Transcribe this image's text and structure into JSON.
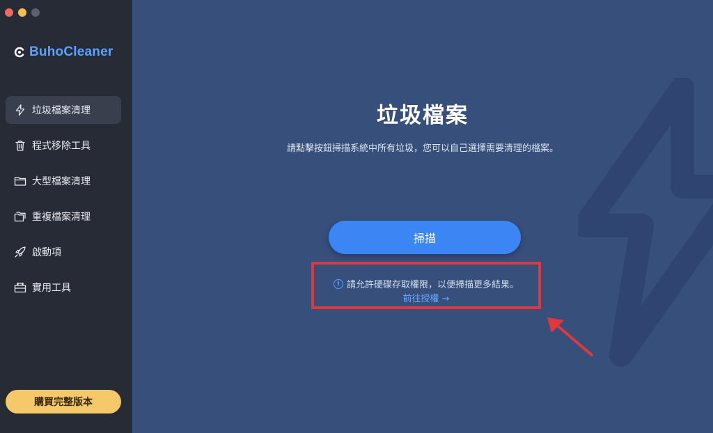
{
  "app": {
    "name": "BuhoCleaner"
  },
  "sidebar": {
    "items": [
      {
        "label": "垃圾檔案清理",
        "icon": "lightning-icon",
        "active": true
      },
      {
        "label": "程式移除工具",
        "icon": "trash-icon",
        "active": false
      },
      {
        "label": "大型檔案清理",
        "icon": "folder-icon",
        "active": false
      },
      {
        "label": "重複檔案清理",
        "icon": "duplicate-folder-icon",
        "active": false
      },
      {
        "label": "啟動項",
        "icon": "rocket-icon",
        "active": false
      },
      {
        "label": "實用工具",
        "icon": "toolbox-icon",
        "active": false
      }
    ],
    "buy_label": "購買完整版本"
  },
  "main": {
    "title": "垃圾檔案",
    "subtitle": "請點擊按鈕掃描系統中所有垃圾，您可以自己選擇需要清理的檔案。",
    "scan_label": "掃描",
    "notice": {
      "text": "請允許硬碟存取權限，以便掃描更多結果。",
      "link": "前往授權 →"
    }
  },
  "colors": {
    "sidebar_bg": "#272b36",
    "main_bg": "#374f7b",
    "accent": "#3b85f5",
    "buy": "#f5c96a",
    "annotation": "#e2373d"
  }
}
